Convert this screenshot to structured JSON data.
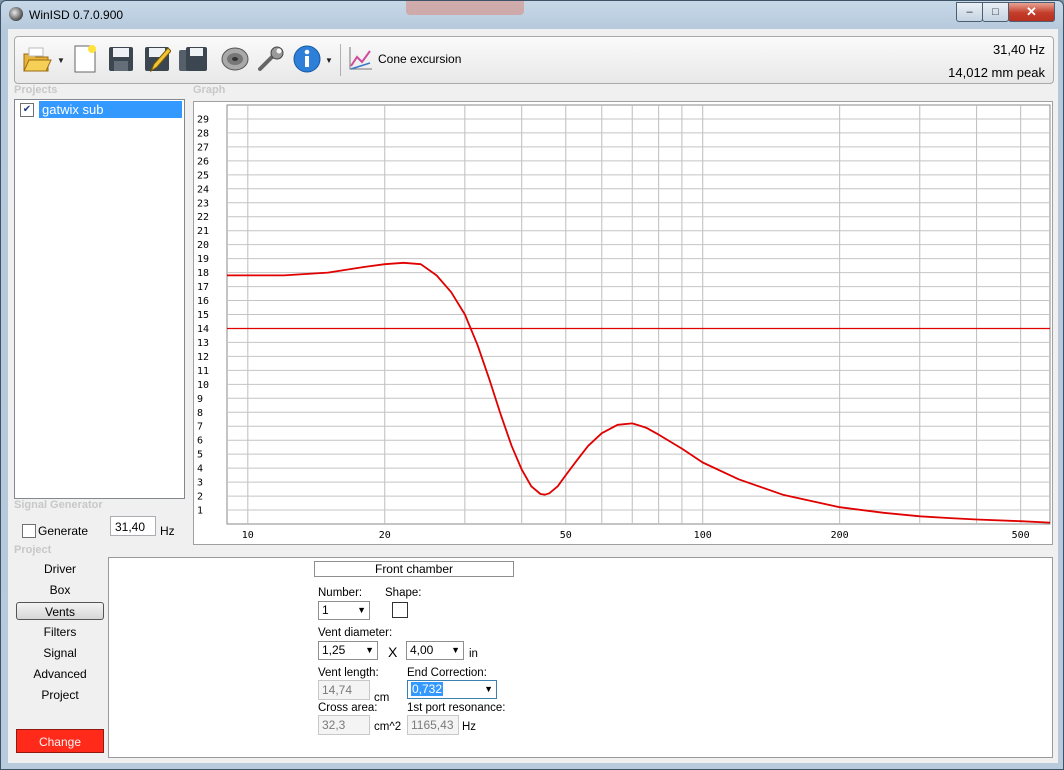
{
  "window": {
    "title": "WinISD 0.7.0.900",
    "minimize": "–",
    "maximize": "□",
    "close": "✕"
  },
  "toolbar": {
    "icons": [
      "open-folder-icon",
      "new-document-icon",
      "save-icon",
      "save-as-icon",
      "save-all-icon",
      "speaker-icon",
      "wrench-icon",
      "info-icon",
      "chart-icon"
    ],
    "cone_label": "Cone excursion",
    "readout_freq": "31,40 Hz",
    "readout_value": "14,012 mm peak"
  },
  "projects": {
    "label": "Projects",
    "items": [
      {
        "name": "gatwix sub",
        "checked": true,
        "check_glyph": "✔"
      }
    ]
  },
  "graph": {
    "label": "Graph"
  },
  "chart_data": {
    "type": "line",
    "title": "",
    "xlabel": "",
    "ylabel": "",
    "xscale": "log",
    "xlim": [
      9,
      580
    ],
    "ylim": [
      0,
      30
    ],
    "x_tick_labels": [
      "10",
      "20",
      "50",
      "100",
      "200",
      "500"
    ],
    "y_tick_labels": [
      "1",
      "2",
      "3",
      "4",
      "5",
      "6",
      "7",
      "8",
      "9",
      "10",
      "11",
      "12",
      "13",
      "14",
      "15",
      "16",
      "17",
      "18",
      "19",
      "20",
      "21",
      "22",
      "23",
      "24",
      "25",
      "26",
      "27",
      "28",
      "29"
    ],
    "grid": true,
    "series": [
      {
        "color": "#e00000",
        "x": [
          9,
          12,
          15,
          18,
          20,
          22,
          24,
          26,
          28,
          30,
          32,
          34,
          36,
          38,
          40,
          42,
          44,
          45,
          46,
          48,
          50,
          53,
          56,
          60,
          65,
          70,
          75,
          80,
          90,
          100,
          120,
          150,
          200,
          250,
          300,
          350,
          400,
          500,
          580
        ],
        "y": [
          17.8,
          17.8,
          18.0,
          18.4,
          18.6,
          18.7,
          18.6,
          17.8,
          16.6,
          15.0,
          12.8,
          10.3,
          7.8,
          5.6,
          3.9,
          2.7,
          2.15,
          2.1,
          2.2,
          2.7,
          3.5,
          4.6,
          5.6,
          6.5,
          7.1,
          7.2,
          6.9,
          6.4,
          5.4,
          4.4,
          3.2,
          2.1,
          1.2,
          0.8,
          0.55,
          0.42,
          0.32,
          0.2,
          0.1
        ]
      },
      {
        "color": "#e00000",
        "x": [
          9,
          580
        ],
        "y": [
          14.0,
          14.0
        ]
      }
    ]
  },
  "signal_generator": {
    "label": "Signal Generator",
    "generate_label": "Generate",
    "frequency": "31,40",
    "unit": "Hz"
  },
  "project_nav": {
    "label": "Project",
    "items": [
      "Driver",
      "Box",
      "Vents",
      "Filters",
      "Signal",
      "Advanced",
      "Project"
    ],
    "active": "Vents",
    "change_label": "Change",
    "change_color": "#ff2a1a"
  },
  "vents": {
    "chamber": "Front chamber",
    "number_label": "Number:",
    "number_value": "1",
    "shape_label": "Shape:",
    "diameter_label": "Vent diameter:",
    "diameter_value": "1,25",
    "times": "X",
    "diameter_value2": "4,00",
    "diameter_unit": "in",
    "length_label": "Vent length:",
    "length_value": "14,74",
    "length_unit": "cm",
    "end_correction_label": "End Correction:",
    "end_correction_value": "0,732",
    "cross_area_label": "Cross area:",
    "cross_area_value": "32,3",
    "cross_area_unit": "cm^2",
    "port_resonance_label": "1st port resonance:",
    "port_resonance_value": "1165,43",
    "port_resonance_unit": "Hz"
  }
}
